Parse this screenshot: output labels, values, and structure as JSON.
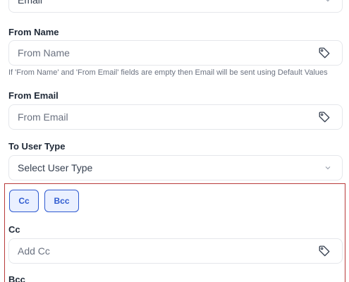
{
  "top_select": {
    "value": "Email"
  },
  "from_name": {
    "label": "From Name",
    "placeholder": "From Name",
    "hint": "If 'From Name' and 'From Email' fields are empty then Email will be sent using Default Values"
  },
  "from_email": {
    "label": "From Email",
    "placeholder": "From Email"
  },
  "to_user_type": {
    "label": "To User Type",
    "placeholder": "Select User Type"
  },
  "cc_section": {
    "cc_button": "Cc",
    "bcc_button": "Bcc",
    "cc_label": "Cc",
    "cc_placeholder": "Add Cc",
    "bcc_label": "Bcc"
  },
  "colors": {
    "accent": "#2f5bd0",
    "highlight_border": "#b83a3a"
  },
  "icons": {
    "tag": "tag-icon",
    "chevron": "chevron-down-icon"
  }
}
